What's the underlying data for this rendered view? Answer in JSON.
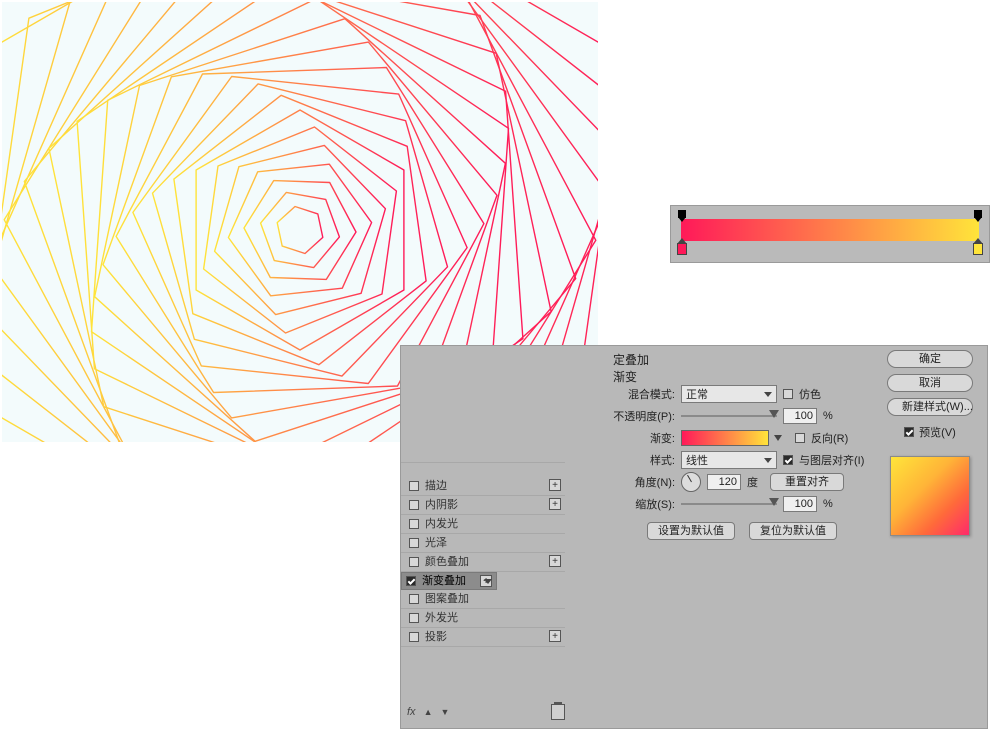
{
  "gradient": {
    "c1": "#ff1959",
    "c2": "#ffe43a",
    "stops_top": [
      0,
      100
    ],
    "stop_bottom_left_color": "#ff1959",
    "stop_bottom_right_color": "#ffe43a"
  },
  "gradient_bar": {
    "label": "gradient editor preview"
  },
  "dialog": {
    "group_title": "定叠加",
    "section_title": "渐变",
    "styles": [
      {
        "label": "描边",
        "checked": false,
        "plus": true
      },
      {
        "label": "内阴影",
        "checked": false,
        "plus": true
      },
      {
        "label": "内发光",
        "checked": false,
        "plus": false
      },
      {
        "label": "光泽",
        "checked": false,
        "plus": false
      },
      {
        "label": "颜色叠加",
        "checked": false,
        "plus": true
      },
      {
        "label": "渐变叠加",
        "checked": true,
        "plus": true,
        "selected": true
      },
      {
        "label": "图案叠加",
        "checked": false,
        "plus": false
      },
      {
        "label": "外发光",
        "checked": false,
        "plus": false
      },
      {
        "label": "投影",
        "checked": false,
        "plus": true
      }
    ],
    "fx_label": "fx",
    "up_icon": "▲",
    "down_icon": "▼",
    "form": {
      "blend_label": "混合模式:",
      "blend_value": "正常",
      "dither_label": "仿色",
      "opacity_label": "不透明度(P):",
      "opacity_value": "100",
      "opacity_unit": "%",
      "gradient_label": "渐变:",
      "reverse_label": "反向(R)",
      "style_label": "样式:",
      "style_value": "线性",
      "align_label": "与图层对齐(I)",
      "angle_label": "角度(N):",
      "angle_value": "120",
      "angle_unit": "度",
      "reset_align": "重置对齐",
      "scale_label": "缩放(S):",
      "scale_value": "100",
      "scale_unit": "%",
      "set_default": "设置为默认值",
      "reset_default": "复位为默认值"
    },
    "right": {
      "ok": "确定",
      "cancel": "取消",
      "new_style": "新建样式(W)...",
      "preview_label": "预览(V)",
      "preview_checked": true
    }
  }
}
